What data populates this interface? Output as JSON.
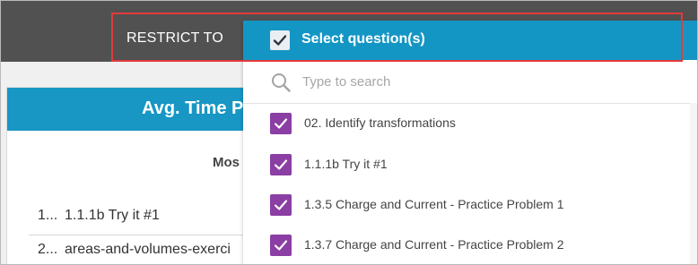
{
  "header": {
    "restrict_label": "RESTRICT TO"
  },
  "panel": {
    "title": "Avg. Time P",
    "subtitle": "Mos",
    "rows": [
      {
        "num": "1...",
        "text": "1.1.1b Try it #1"
      },
      {
        "num": "2...",
        "text": "areas-and-volumes-exerci"
      }
    ]
  },
  "dropdown": {
    "header_label": "Select question(s)",
    "search_placeholder": "Type to search",
    "options": [
      {
        "label": "02. Identify transformations",
        "checked": true
      },
      {
        "label": "1.1.1b Try it #1",
        "checked": true
      },
      {
        "label": "1.3.5 Charge and Current - Practice Problem 1",
        "checked": true
      },
      {
        "label": "1.3.7 Charge and Current - Practice Problem 2",
        "checked": true
      }
    ]
  },
  "colors": {
    "header_bar": "#515151",
    "accent_blue": "#1496c4",
    "checkbox_purple": "#8b3ea3",
    "highlight_red": "#e23b3b"
  },
  "icons": {
    "header_check": "checkmark-icon",
    "search": "search-icon",
    "option_check": "checkmark-icon"
  }
}
